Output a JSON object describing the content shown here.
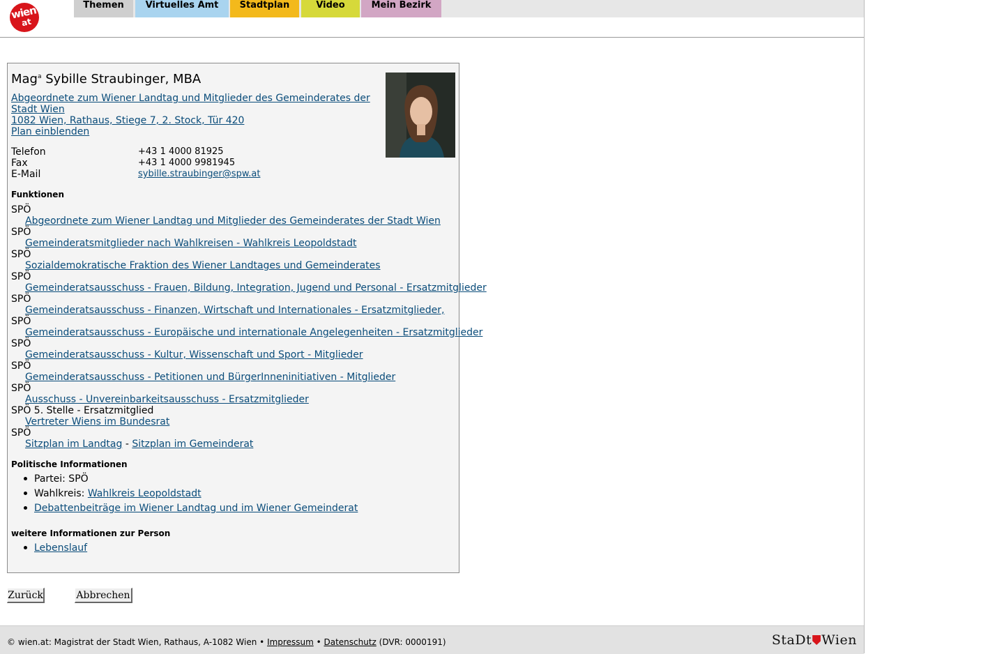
{
  "nav": {
    "tabs": [
      {
        "label": "Themen",
        "color": "#cfcfcf"
      },
      {
        "label": "Virtuelles Amt",
        "color": "#a9d4ef"
      },
      {
        "label": "Stadtplan",
        "color": "#f3b91b"
      },
      {
        "label": "Video",
        "color": "#d6d93a"
      },
      {
        "label": "Mein Bezirk",
        "color": "#d2a6c4"
      }
    ]
  },
  "person": {
    "title_prefix": "Mag",
    "title_suffix": "a",
    "name": " Sybille Straubinger, MBA",
    "role_line1": "Abgeordnete zum Wiener Landtag und Mitglieder des Gemeinderates der",
    "role_line2": "Stadt Wien ",
    "address": "1082 Wien, Rathaus, Stiege 7, 2. Stock, Tür 420",
    "plan_link": "Plan einblenden"
  },
  "contact": {
    "phone_label": "Telefon",
    "phone": "+43 1 4000 81925",
    "fax_label": "Fax",
    "fax": "+43 1 4000 9981945",
    "email_label": "E-Mail",
    "email": "sybille.straubinger@spw.at"
  },
  "functions": {
    "heading": "Funktionen",
    "items": [
      {
        "party": "SPÖ",
        "link": "Abgeordnete zum Wiener Landtag und Mitglieder des Gemeinderates der Stadt Wien"
      },
      {
        "party": "SPÖ",
        "link": "Gemeinderatsmitglieder nach Wahlkreisen - Wahlkreis Leopoldstadt"
      },
      {
        "party": "SPÖ",
        "link": "Sozialdemokratische Fraktion des Wiener Landtages und Gemeinderates"
      },
      {
        "party": "SPÖ",
        "link": "Gemeinderatsausschuss - Frauen, Bildung, Integration, Jugend und Personal - Ersatzmitglieder"
      },
      {
        "party": "SPÖ",
        "link": "Gemeinderatsausschuss - Finanzen, Wirtschaft und Internationales - Ersatzmitglieder, "
      },
      {
        "party": "SPÖ",
        "link": "Gemeinderatsausschuss - Europäische und internationale Angelegenheiten - Ersatzmitglieder"
      },
      {
        "party": "SPÖ",
        "link": "Gemeinderatsausschuss - Kultur, Wissenschaft und Sport - Mitglieder"
      },
      {
        "party": "SPÖ",
        "link": "Gemeinderatsausschuss - Petitionen und BürgerInneninitiativen - Mitglieder"
      },
      {
        "party": "SPÖ",
        "link": "Ausschuss - Unvereinbarkeitsausschuss - Ersatzmitglieder"
      },
      {
        "party": "SPÖ 5. Stelle - Ersatzmitglied",
        "link": "Vertreter Wiens im Bundesrat"
      }
    ],
    "last_party": "SPÖ",
    "seat_landtag": "Sitzplan im Landtag",
    "seat_sep": " - ",
    "seat_gemeinderat": "Sitzplan im Gemeinderat"
  },
  "political": {
    "heading": "Politische Informationen",
    "party_text": "Partei: SPÖ",
    "district_label": "Wahlkreis: ",
    "district_link": "Wahlkreis Leopoldstadt",
    "debate_link": "Debattenbeiträge im Wiener Landtag und im Wiener Gemeinderat"
  },
  "more": {
    "heading": "weitere Informationen zur Person",
    "cv_link": "Lebenslauf"
  },
  "buttons": {
    "back": "Zurück",
    "cancel": "Abbrechen"
  },
  "footer": {
    "text": "© wien.at: Magistrat der Stadt Wien, Rathaus, A-1082 Wien • ",
    "impressum": "Impressum",
    "sep": " • ",
    "datenschutz": "Datenschutz",
    "dvr": " (DVR: 0000191)",
    "brand_left": "StaDt",
    "brand_right": "Wien"
  },
  "logo": {
    "word1": "wien",
    "word2": "at",
    "color": "#d8151b"
  }
}
